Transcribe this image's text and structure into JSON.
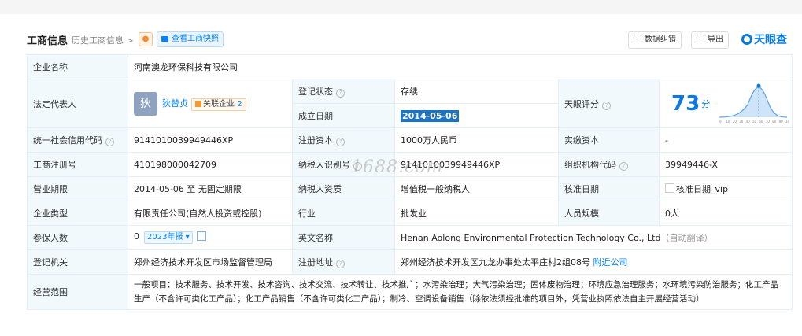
{
  "header": {
    "title": "工商信息",
    "history": "历史工商信息 >",
    "snapshot": "查看工商快照",
    "correction": "数据纠错",
    "export": "导出",
    "logo": "天眼查"
  },
  "watermark": "1688.com",
  "rows": {
    "company_name": {
      "label": "企业名称",
      "value": "河南澳龙环保科技有限公司"
    },
    "legal_rep": {
      "label": "法定代表人",
      "avatar": "狄",
      "name": "狄替贞",
      "related": "关联企业",
      "related_count": "2"
    },
    "reg_status": {
      "label": "登记状态",
      "value": "存续"
    },
    "establish_date": {
      "label": "成立日期",
      "value": "2014-05-06"
    },
    "score": {
      "label": "天眼评分",
      "value": "73",
      "unit": "分",
      "axis": [
        "0",
        "10",
        "20",
        "30",
        "40",
        "50",
        "60",
        "70",
        "80",
        "90",
        "100"
      ]
    },
    "credit_code": {
      "label": "统一社会信用代码",
      "value": "9141010039949446XP"
    },
    "reg_capital": {
      "label": "注册资本",
      "value": "1000万人民币"
    },
    "paid_capital": {
      "label": "实缴资本",
      "value": "-"
    },
    "reg_number": {
      "label": "工商注册号",
      "value": "410198000042709"
    },
    "taxpayer_id": {
      "label": "纳税人识别号",
      "value": "9141010039949446XP"
    },
    "org_code": {
      "label": "组织机构代码",
      "value": "39949446-X"
    },
    "business_term": {
      "label": "营业期限",
      "value": "2014-05-06 至 无固定期限"
    },
    "taxpayer_type": {
      "label": "纳税人资质",
      "value": "增值税一般纳税人"
    },
    "approval_date": {
      "label": "核准日期",
      "value": "核准日期_vip"
    },
    "company_type": {
      "label": "企业类型",
      "value": "有限责任公司(自然人投资或控股)"
    },
    "industry": {
      "label": "行业",
      "value": "批发业"
    },
    "staff_size": {
      "label": "人员规模",
      "value": "0人"
    },
    "insured": {
      "label": "参保人数",
      "value": "0",
      "tag": "2023年报"
    },
    "english_name": {
      "label": "英文名称",
      "value": "Henan Aolong Environmental Protection Technology Co., Ltd",
      "auto": "（自动翻译）"
    },
    "authority": {
      "label": "登记机关",
      "value": "郑州经济技术开发区市场监督管理局"
    },
    "address": {
      "label": "注册地址",
      "value": "郑州经济技术开发区九龙办事处太平庄村2组08号",
      "nearby": "附近公司"
    },
    "scope": {
      "label": "经营范围",
      "value": "一般项目：技术服务、技术开发、技术咨询、技术交流、技术转让、技术推广；水污染治理；大气污染治理；固体废物治理；环境应急治理服务；水环境污染防治服务；化工产品生产（不含许可类化工产品）；化工产品销售（不含许可类化工产品）；制冷、空调设备销售（除依法须经批准的项目外，凭营业执照依法自主开展经营活动）"
    }
  },
  "colors": {
    "accent": "#0a7ae0",
    "status_green": "#1aaa55",
    "label_bg": "#f2f9fc",
    "border": "#e4eef6"
  }
}
